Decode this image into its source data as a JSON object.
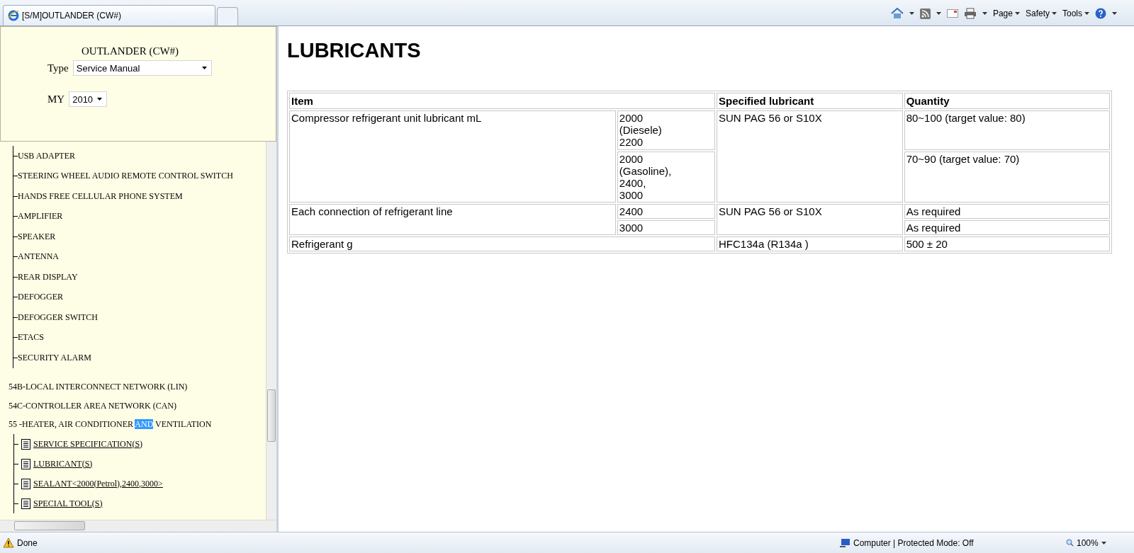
{
  "browser": {
    "tab_title": "[S/M]OUTLANDER (CW#)",
    "menus": [
      "Page",
      "Safety",
      "Tools"
    ]
  },
  "sidebar": {
    "title": "OUTLANDER (CW#)",
    "type_label": "Type",
    "type_value": "Service Manual",
    "my_label": "MY",
    "my_value": "2010",
    "branch_items": [
      "USB ADAPTER",
      "STEERING WHEEL AUDIO REMOTE CONTROL SWITCH",
      "HANDS FREE CELLULAR PHONE SYSTEM",
      "AMPLIFIER",
      "SPEAKER",
      "ANTENNA",
      "REAR DISPLAY",
      "DEFOGGER",
      "DEFOGGER SWITCH",
      "ETACS",
      "SECURITY ALARM"
    ],
    "sections": [
      {
        "label": "54B-LOCAL INTERCONNECT NETWORK (LIN)"
      },
      {
        "label": "54C-CONTROLLER AREA NETWORK (CAN)"
      },
      {
        "label": "55 -HEATER, AIR CONDITIONER ",
        "highlight": "AND",
        "label_end": " VENTILATION",
        "children": [
          {
            "label": "SERVICE SPECIFICATION(S)"
          },
          {
            "label": "LUBRICANT(S)"
          },
          {
            "label": "SEALANT<2000(Petrol),2400,3000>"
          },
          {
            "label": "SPECIAL TOOL(S)"
          }
        ]
      }
    ]
  },
  "page": {
    "heading": "LUBRICANTS",
    "table": {
      "columns": [
        "Item",
        "Specified lubricant",
        "Quantity"
      ],
      "groups": [
        {
          "item": "Compressor refrigerant unit lubricant mL",
          "lubricant": "SUN PAG 56 or S10X",
          "entries": [
            {
              "engine": "2000\n(Diesele)\n2200",
              "quantity": "80~100 (target value: 80)"
            },
            {
              "engine": "2000\n(Gasoline),\n2400,\n3000",
              "quantity": "70~90 (target value: 70)"
            }
          ]
        },
        {
          "item": "Each connection of refrigerant line",
          "lubricant": "SUN PAG 56 or S10X",
          "entries": [
            {
              "engine": "2400",
              "quantity": "As required"
            },
            {
              "engine": "3000",
              "quantity": "As required"
            }
          ]
        },
        {
          "item": "Refrigerant g",
          "lubricant": "HFC134a (R134a )",
          "entries": [
            {
              "quantity": "500 ± 20"
            }
          ]
        }
      ]
    }
  },
  "status_bar": {
    "text": "Done",
    "zone": "Computer | Protected Mode: Off",
    "zoom": "100%"
  }
}
